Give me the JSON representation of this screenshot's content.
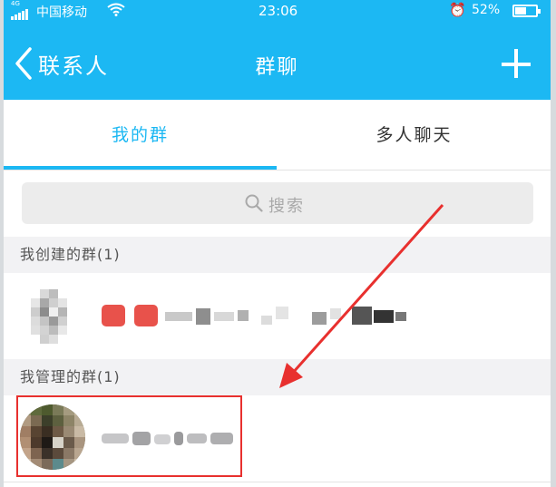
{
  "status_bar": {
    "network": "4G",
    "carrier": "中国移动",
    "wifi_icon": "wifi",
    "time": "23:06",
    "alarm_icon": "⏰",
    "battery": "52%",
    "battery_level": 0.52
  },
  "nav": {
    "back_label": "联系人",
    "title": "群聊"
  },
  "tabs": {
    "my_groups": "我的群",
    "multi_chat": "多人聊天"
  },
  "search": {
    "placeholder": "搜索"
  },
  "sections": {
    "created": "我创建的群(1)",
    "managed": "我管理的群(1)"
  },
  "colors": {
    "accent": "#1cb8f3",
    "annotation": "#e8302e"
  }
}
